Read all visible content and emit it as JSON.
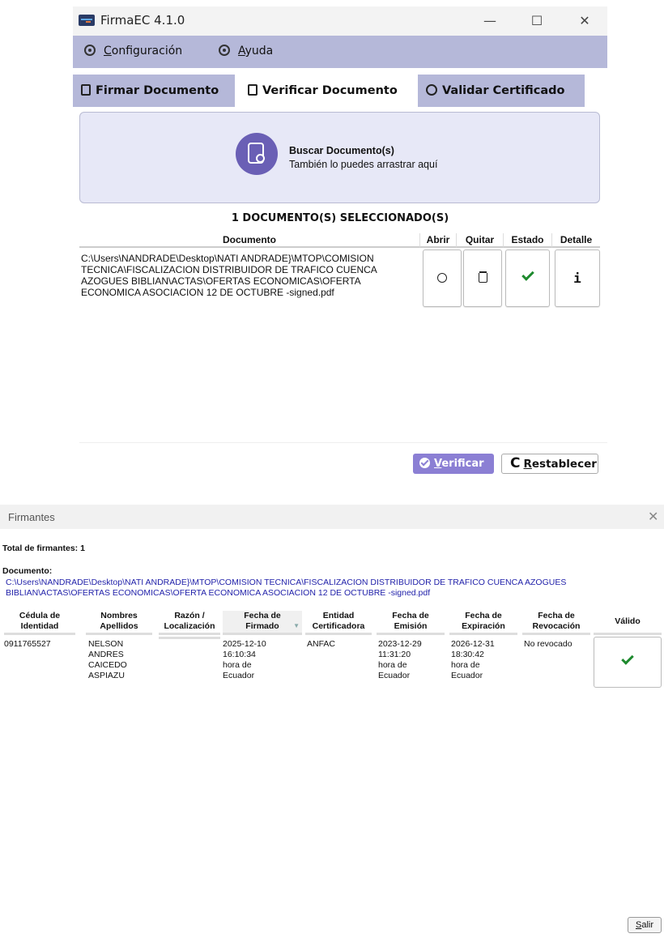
{
  "window": {
    "title": "FirmaEC 4.1.0",
    "controls": {
      "minimize": "—",
      "maximize": "☐",
      "close": "✕"
    }
  },
  "menu": {
    "configuracion_pre": "C",
    "configuracion_rest": "onfiguración",
    "ayuda_pre": "A",
    "ayuda_rest": "yuda"
  },
  "tabs": [
    {
      "label": "Firmar Documento (1)"
    },
    {
      "label": "Verificar Documento (2)"
    },
    {
      "label": "Validar Certificado (3)"
    }
  ],
  "search_panel": {
    "title": "Buscar Documento(s)",
    "subtitle": "También lo puedes arrastrar aquí"
  },
  "selection_count": "1 DOCUMENTO(S) SELECCIONADO(S)",
  "doc_table": {
    "headers": {
      "documento": "Documento",
      "abrir": "Abrir",
      "quitar": "Quitar",
      "estado": "Estado",
      "detalle": "Detalle"
    },
    "row": {
      "path": "C:\\Users\\NANDRADE\\Desktop\\NATI ANDRADE}\\MTOP\\COMISION TECNICA\\FISCALIZACION DISTRIBUIDOR DE TRAFICO CUENCA AZOGUES BIBLIAN\\ACTAS\\OFERTAS ECONOMICAS\\OFERTA ECONOMICA ASOCIACION 12 DE OCTUBRE -signed.pdf",
      "abrir_icon": "search-icon",
      "quitar_icon": "trash-icon",
      "estado_icon": "check-icon",
      "detalle_icon": "info-icon",
      "detalle_glyph": "i"
    }
  },
  "actions": {
    "verificar_pre": "V",
    "verificar_rest": "erificar",
    "restablecer_pre": "R",
    "restablecer_rest": "establecer",
    "restablecer_glyph": "C"
  },
  "dialog": {
    "title": "Firmantes",
    "close": "✕",
    "total": "Total de firmantes: 1",
    "doc_label": "Documento:",
    "doc_path": "C:\\Users\\NANDRADE\\Desktop\\NATI ANDRADE}\\MTOP\\COMISION TECNICA\\FISCALIZACION DISTRIBUIDOR DE TRAFICO CUENCA AZOGUES BIBLIAN\\ACTAS\\OFERTAS ECONOMICAS\\OFERTA ECONOMICA ASOCIACION 12 DE OCTUBRE -signed.pdf",
    "headers": {
      "cedula": "Cédula de Identidad",
      "nombres": "Nombres Apellidos",
      "razon": "Razón / Localización",
      "fecha_firmado": "Fecha de Firmado",
      "entidad": "Entidad Certificadora",
      "fecha_emision": "Fecha de Emisión",
      "fecha_expiracion": "Fecha de Expiración",
      "fecha_revocacion": "Fecha de Revocación",
      "valido": "Válido"
    },
    "row": {
      "cedula": "0911765527",
      "nombres": "NELSON ANDRES CAICEDO ASPIAZU",
      "razon": "",
      "fecha_firmado": "2025-12-10 16:10:34 hora de Ecuador",
      "entidad": "ANFAC",
      "fecha_emision": "2023-12-29 11:31:20 hora de Ecuador",
      "fecha_expiracion": "2026-12-31 18:30:42 hora de Ecuador",
      "fecha_revocacion": "No revocado",
      "valido_icon": "check-icon"
    },
    "salir_pre": "S",
    "salir_rest": "alir"
  },
  "colors": {
    "menubar": "#b5b8d9",
    "active_tab": "#ffffff",
    "inactive_tab": "#b5b8d9",
    "accent_purple": "#6a5fb5",
    "verificar_button": "#8b7fd4",
    "check_green": "#1e8a2e",
    "link_blue": "#2222aa"
  }
}
